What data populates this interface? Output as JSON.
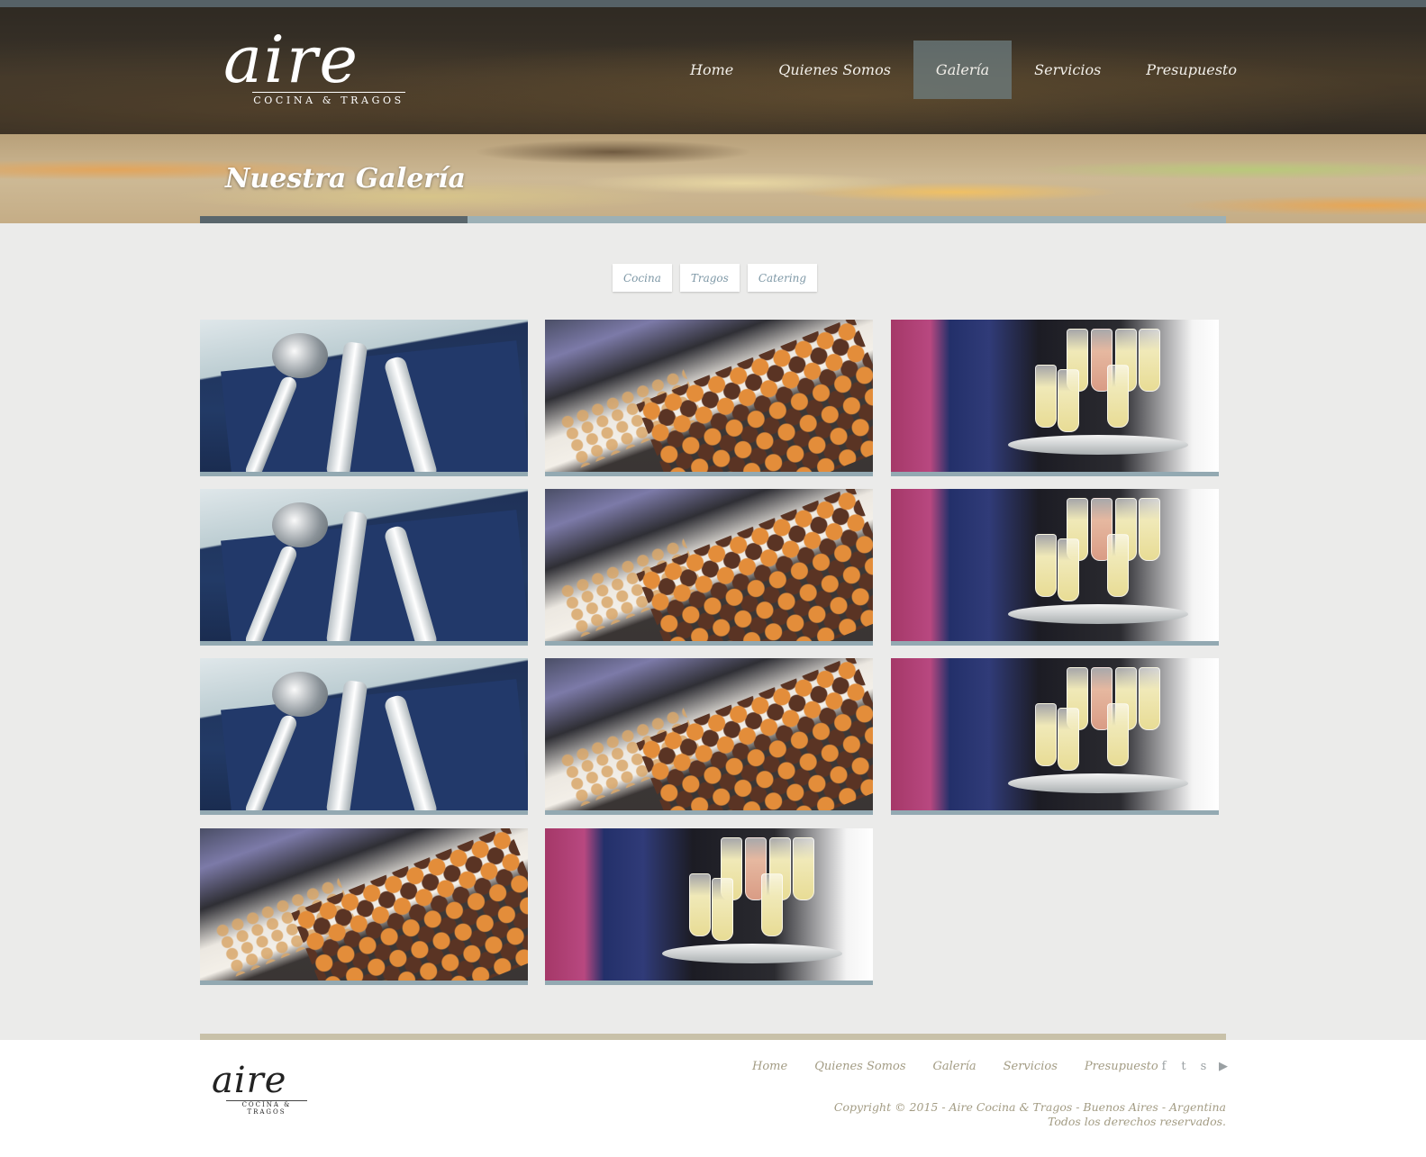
{
  "brand": {
    "name": "aire",
    "tagline": "COCINA & TRAGOS"
  },
  "nav": {
    "items": [
      {
        "label": "Home"
      },
      {
        "label": "Quienes Somos"
      },
      {
        "label": "Galería",
        "active": true
      },
      {
        "label": "Servicios"
      },
      {
        "label": "Presupuesto"
      }
    ]
  },
  "page": {
    "title": "Nuestra Galería"
  },
  "filters": [
    {
      "label": "Cocina"
    },
    {
      "label": "Tragos"
    },
    {
      "label": "Catering"
    }
  ],
  "gallery": {
    "tiles": [
      {
        "image": "cutlery-icon"
      },
      {
        "image": "muffins-icon"
      },
      {
        "image": "champagne-icon"
      },
      {
        "image": "cutlery-icon"
      },
      {
        "image": "muffins-icon"
      },
      {
        "image": "champagne-icon"
      },
      {
        "image": "cutlery-icon"
      },
      {
        "image": "muffins-icon"
      },
      {
        "image": "champagne-icon"
      },
      {
        "image": "muffins-icon"
      },
      {
        "image": "champagne-icon"
      }
    ]
  },
  "footer": {
    "nav": [
      {
        "label": "Home"
      },
      {
        "label": "Quienes Somos"
      },
      {
        "label": "Galería"
      },
      {
        "label": "Servicios"
      },
      {
        "label": "Presupuesto"
      }
    ],
    "social": [
      {
        "icon": "facebook-icon",
        "glyph": "f"
      },
      {
        "icon": "twitter-icon",
        "glyph": "t"
      },
      {
        "icon": "skype-icon",
        "glyph": "s"
      },
      {
        "icon": "youtube-icon",
        "glyph": "▶"
      }
    ],
    "copyright_line1": "Copyright © 2015 - Aire Cocina & Tragos - Buenos Aires - Argentina",
    "copyright_line2": "Todos los derechos reservados."
  },
  "colors": {
    "accent": "#93a9b2",
    "nav_active": "#6e7d80",
    "footer_text": "#a39c84",
    "footer_bar": "#c8c1a9"
  }
}
